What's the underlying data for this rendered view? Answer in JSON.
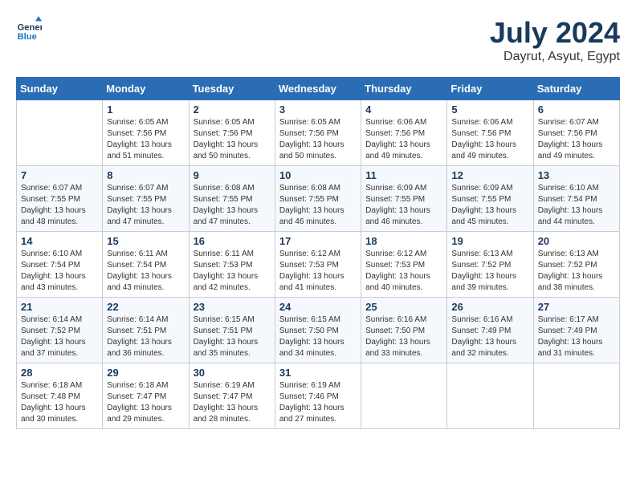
{
  "header": {
    "logo_line1": "General",
    "logo_line2": "Blue",
    "month_year": "July 2024",
    "location": "Dayrut, Asyut, Egypt"
  },
  "columns": [
    "Sunday",
    "Monday",
    "Tuesday",
    "Wednesday",
    "Thursday",
    "Friday",
    "Saturday"
  ],
  "weeks": [
    [
      {
        "day": "",
        "info": ""
      },
      {
        "day": "1",
        "info": "Sunrise: 6:05 AM\nSunset: 7:56 PM\nDaylight: 13 hours\nand 51 minutes."
      },
      {
        "day": "2",
        "info": "Sunrise: 6:05 AM\nSunset: 7:56 PM\nDaylight: 13 hours\nand 50 minutes."
      },
      {
        "day": "3",
        "info": "Sunrise: 6:05 AM\nSunset: 7:56 PM\nDaylight: 13 hours\nand 50 minutes."
      },
      {
        "day": "4",
        "info": "Sunrise: 6:06 AM\nSunset: 7:56 PM\nDaylight: 13 hours\nand 49 minutes."
      },
      {
        "day": "5",
        "info": "Sunrise: 6:06 AM\nSunset: 7:56 PM\nDaylight: 13 hours\nand 49 minutes."
      },
      {
        "day": "6",
        "info": "Sunrise: 6:07 AM\nSunset: 7:56 PM\nDaylight: 13 hours\nand 49 minutes."
      }
    ],
    [
      {
        "day": "7",
        "info": "Sunrise: 6:07 AM\nSunset: 7:55 PM\nDaylight: 13 hours\nand 48 minutes."
      },
      {
        "day": "8",
        "info": "Sunrise: 6:07 AM\nSunset: 7:55 PM\nDaylight: 13 hours\nand 47 minutes."
      },
      {
        "day": "9",
        "info": "Sunrise: 6:08 AM\nSunset: 7:55 PM\nDaylight: 13 hours\nand 47 minutes."
      },
      {
        "day": "10",
        "info": "Sunrise: 6:08 AM\nSunset: 7:55 PM\nDaylight: 13 hours\nand 46 minutes."
      },
      {
        "day": "11",
        "info": "Sunrise: 6:09 AM\nSunset: 7:55 PM\nDaylight: 13 hours\nand 46 minutes."
      },
      {
        "day": "12",
        "info": "Sunrise: 6:09 AM\nSunset: 7:55 PM\nDaylight: 13 hours\nand 45 minutes."
      },
      {
        "day": "13",
        "info": "Sunrise: 6:10 AM\nSunset: 7:54 PM\nDaylight: 13 hours\nand 44 minutes."
      }
    ],
    [
      {
        "day": "14",
        "info": "Sunrise: 6:10 AM\nSunset: 7:54 PM\nDaylight: 13 hours\nand 43 minutes."
      },
      {
        "day": "15",
        "info": "Sunrise: 6:11 AM\nSunset: 7:54 PM\nDaylight: 13 hours\nand 43 minutes."
      },
      {
        "day": "16",
        "info": "Sunrise: 6:11 AM\nSunset: 7:53 PM\nDaylight: 13 hours\nand 42 minutes."
      },
      {
        "day": "17",
        "info": "Sunrise: 6:12 AM\nSunset: 7:53 PM\nDaylight: 13 hours\nand 41 minutes."
      },
      {
        "day": "18",
        "info": "Sunrise: 6:12 AM\nSunset: 7:53 PM\nDaylight: 13 hours\nand 40 minutes."
      },
      {
        "day": "19",
        "info": "Sunrise: 6:13 AM\nSunset: 7:52 PM\nDaylight: 13 hours\nand 39 minutes."
      },
      {
        "day": "20",
        "info": "Sunrise: 6:13 AM\nSunset: 7:52 PM\nDaylight: 13 hours\nand 38 minutes."
      }
    ],
    [
      {
        "day": "21",
        "info": "Sunrise: 6:14 AM\nSunset: 7:52 PM\nDaylight: 13 hours\nand 37 minutes."
      },
      {
        "day": "22",
        "info": "Sunrise: 6:14 AM\nSunset: 7:51 PM\nDaylight: 13 hours\nand 36 minutes."
      },
      {
        "day": "23",
        "info": "Sunrise: 6:15 AM\nSunset: 7:51 PM\nDaylight: 13 hours\nand 35 minutes."
      },
      {
        "day": "24",
        "info": "Sunrise: 6:15 AM\nSunset: 7:50 PM\nDaylight: 13 hours\nand 34 minutes."
      },
      {
        "day": "25",
        "info": "Sunrise: 6:16 AM\nSunset: 7:50 PM\nDaylight: 13 hours\nand 33 minutes."
      },
      {
        "day": "26",
        "info": "Sunrise: 6:16 AM\nSunset: 7:49 PM\nDaylight: 13 hours\nand 32 minutes."
      },
      {
        "day": "27",
        "info": "Sunrise: 6:17 AM\nSunset: 7:49 PM\nDaylight: 13 hours\nand 31 minutes."
      }
    ],
    [
      {
        "day": "28",
        "info": "Sunrise: 6:18 AM\nSunset: 7:48 PM\nDaylight: 13 hours\nand 30 minutes."
      },
      {
        "day": "29",
        "info": "Sunrise: 6:18 AM\nSunset: 7:47 PM\nDaylight: 13 hours\nand 29 minutes."
      },
      {
        "day": "30",
        "info": "Sunrise: 6:19 AM\nSunset: 7:47 PM\nDaylight: 13 hours\nand 28 minutes."
      },
      {
        "day": "31",
        "info": "Sunrise: 6:19 AM\nSunset: 7:46 PM\nDaylight: 13 hours\nand 27 minutes."
      },
      {
        "day": "",
        "info": ""
      },
      {
        "day": "",
        "info": ""
      },
      {
        "day": "",
        "info": ""
      }
    ]
  ]
}
